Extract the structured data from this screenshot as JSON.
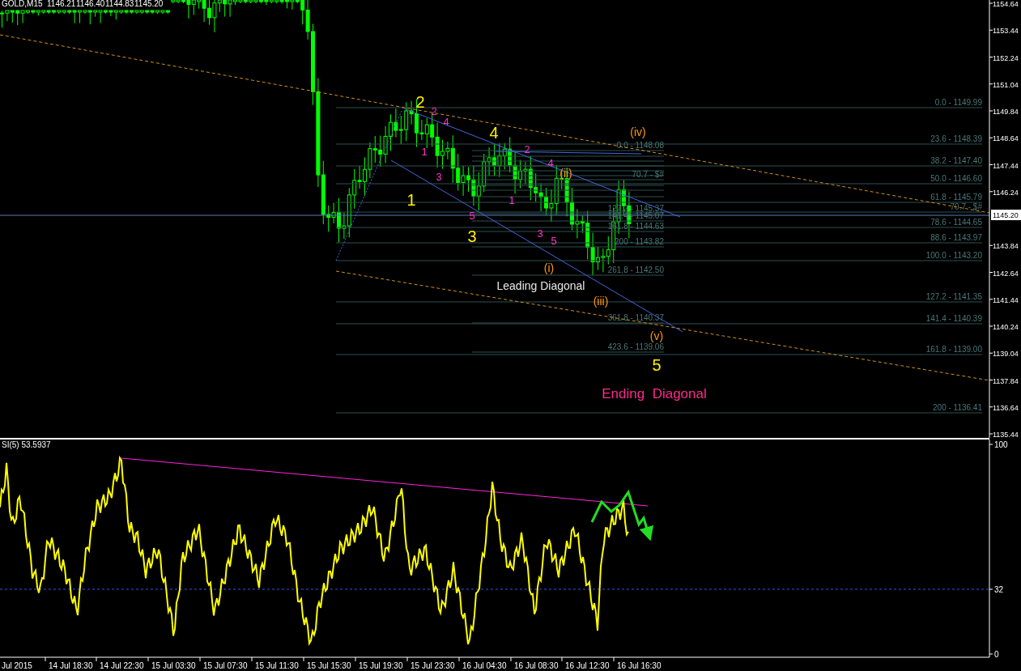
{
  "header": {
    "symbol": "GOLD,M15",
    "quotes": [
      "1146.21",
      "1146.40",
      "1144.83",
      "1145.20"
    ]
  },
  "price_axis": {
    "labels": [
      "1154.64",
      "1153.44",
      "1152.24",
      "1151.04",
      "1149.84",
      "1148.64",
      "1147.44",
      "1146.24",
      "1143.84",
      "1142.64",
      "1141.44",
      "1140.24",
      "1139.04",
      "1137.84",
      "1136.64",
      "1135.44"
    ],
    "current_price": "1145.20"
  },
  "fib_outer": [
    {
      "label": "0.0 - 1149.99"
    },
    {
      "label": "23.6  - 1148.39"
    },
    {
      "label": "38.2 - 1147.40"
    },
    {
      "label": "50.0 - 1146.60"
    },
    {
      "label": "61.8 - 1145.79"
    },
    {
      "label": "70.7 - $#"
    },
    {
      "label": "78.6 - 1144.65"
    },
    {
      "label": "88.6 - 1143.97"
    },
    {
      "label": "100.0 - 1143.20"
    },
    {
      "label": "127.2 - 1141.35"
    },
    {
      "label": "141.4 - 1140.39"
    },
    {
      "label": "161.8 - 1139.00"
    },
    {
      "label": "200 - 1136.41"
    }
  ],
  "fib_inner": [
    {
      "label": "0.0 - 1148.08"
    },
    {
      "label": "70.7 - $#"
    },
    {
      "label": "127.2 - 1145.37"
    },
    {
      "label": "141.4 - 1145.07"
    },
    {
      "label": "161.8 - 1144.63"
    },
    {
      "label": "200 - 1143.82"
    },
    {
      "label": "261.8 - 1142.50"
    },
    {
      "label": "361.8 - 1140.37"
    },
    {
      "label": "423.6 - 1139.06"
    }
  ],
  "wave_labels": [
    {
      "text": "2",
      "kind": "primary"
    },
    {
      "text": "4",
      "kind": "primary"
    },
    {
      "text": "1",
      "kind": "primary"
    },
    {
      "text": "3",
      "kind": "primary"
    },
    {
      "text": "5",
      "kind": "primary"
    },
    {
      "text": "2",
      "kind": "minor"
    },
    {
      "text": "4",
      "kind": "minor"
    },
    {
      "text": "1",
      "kind": "minor"
    },
    {
      "text": "3",
      "kind": "minor"
    },
    {
      "text": "5",
      "kind": "minor"
    },
    {
      "text": "2",
      "kind": "minor"
    },
    {
      "text": "4",
      "kind": "minor"
    },
    {
      "text": "1",
      "kind": "minor"
    },
    {
      "text": "3",
      "kind": "minor"
    },
    {
      "text": "5",
      "kind": "minor"
    },
    {
      "text": "(iv)",
      "kind": "sub"
    },
    {
      "text": "(ii)",
      "kind": "sub"
    },
    {
      "text": "(i)",
      "kind": "sub"
    },
    {
      "text": "(iii)",
      "kind": "sub"
    },
    {
      "text": "(v)",
      "kind": "sub"
    },
    {
      "text": "Leading Diagonal",
      "kind": "note"
    },
    {
      "text": "Ending  Diagonal",
      "kind": "title"
    }
  ],
  "indicator": {
    "label": "SI(5) 53.5937",
    "axis_labels": [
      "100",
      "32",
      "0"
    ]
  },
  "time_axis": [
    "Jul 2015",
    "14 Jul 18:30",
    "14 Jul 22:30",
    "15 Jul 03:30",
    "15 Jul 07:30",
    "15 Jul 11:30",
    "15 Jul 15:30",
    "15 Jul 19:30",
    "15 Jul 23:30",
    "16 Jul 04:30",
    "16 Jul 08:30",
    "16 Jul 12:30",
    "16 Jul 16:30"
  ]
}
